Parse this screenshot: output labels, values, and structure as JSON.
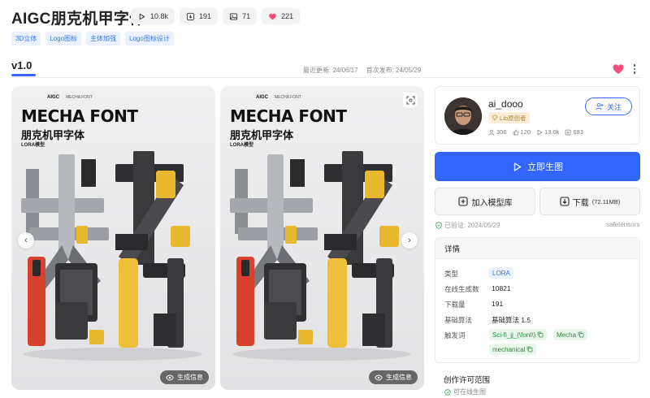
{
  "header": {
    "title": "AIGC朋克机甲字体",
    "stats": {
      "runs": "10.8k",
      "downloads": "191",
      "images": "71",
      "likes": "221"
    },
    "tags": [
      "3D立体",
      "Logo图标",
      "主体加强",
      "Logo图标设计"
    ]
  },
  "version": {
    "label": "v1.0",
    "last_updated": "最近更新: 24/06/17",
    "first_published": "首次发布: 24/05/29"
  },
  "gallery": {
    "poster": {
      "top_bar": "AIGC",
      "top_bar_right": "MECHA FONT",
      "title": "MECHA FONT",
      "subtitle": "朋克机甲字体",
      "model_label": "LORA模型"
    },
    "gen_info_label": "生成信息"
  },
  "author": {
    "name": "ai_dooo",
    "badge": "Lib原创者",
    "stat_followers": "306",
    "stat_likes": "120",
    "stat_runs": "13.0k",
    "stat_downloads": "693",
    "follow_label": "关注"
  },
  "actions": {
    "run_label": "立即生图",
    "add_label": "加入模型库",
    "download_label": "下载",
    "download_size": "(72.11MB)"
  },
  "verification": {
    "verified": "已验证: 2024/05/29",
    "format": "safetensors"
  },
  "details": {
    "title": "详情",
    "type_label": "类型",
    "type_value": "LORA",
    "online_label": "在线生成数",
    "online_value": "10821",
    "downloads_label": "下载量",
    "downloads_value": "191",
    "base_label": "基础算法",
    "base_value": "基础算法 1.5",
    "trigger_label": "触发词",
    "triggers": [
      "Sci-fi_jj_(\\font\\)",
      "Mecha",
      "mechanical"
    ]
  },
  "license": {
    "title": "创作许可范围",
    "item": "可在线生图"
  },
  "colors": {
    "accent": "#3366ff",
    "like": "#ef4f7a",
    "tag_bg": "#eaf2ff",
    "trigger_bg": "#e9f7ec"
  }
}
